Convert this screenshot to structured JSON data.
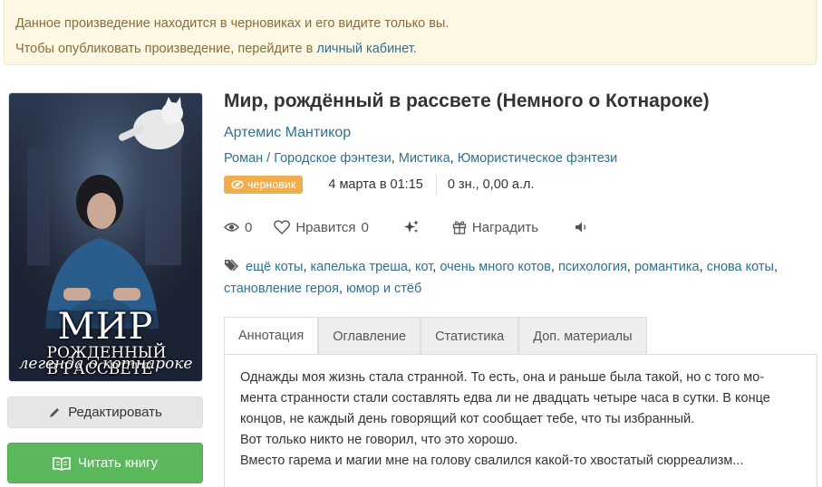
{
  "notice": {
    "line1": "Данное произведение находится в черновиках и его видите только вы.",
    "line2_prefix": "Чтобы опубликовать произведение, перейдите в ",
    "line2_link": "личный кабинет",
    "line2_suffix": "."
  },
  "cover": {
    "title_big": "МИР",
    "title_small_1": "РОЖДЕННЫЙ",
    "title_small_2": "В РАССВЕТЕ",
    "subtitle": "легенда о котнароке"
  },
  "buttons": {
    "edit": "Редактировать",
    "read": "Читать книгу"
  },
  "book": {
    "title": "Мир, рождённый в рассвете (Немного о Котнароке)",
    "author": "Артемис Мантикор",
    "genre_prefix": "Роман / ",
    "genres": [
      "Городское фэнтези",
      "Мистика",
      "Юмористическое фэнтези"
    ],
    "status_badge": "черновик",
    "date": "4 марта в 01:15",
    "size": "0 зн., 0,00 а.л."
  },
  "actions": {
    "views": "0",
    "likes_label": "Нравится",
    "likes_count": "0",
    "reward": "Наградить"
  },
  "tags": [
    "ещё коты",
    "капелька треша",
    "кот",
    "очень много котов",
    "психология",
    "романтика",
    "снова коты",
    "становление героя",
    "юмор и стёб"
  ],
  "tabs": [
    "Аннотация",
    "Оглавление",
    "Статистика",
    "Доп. материалы"
  ],
  "annotation": {
    "l1": "Однажды моя жизнь стала странной. То есть, она и раньше была такой, но с того мо-",
    "l2": "мента странности стали составлять едва ли не двадцать четыре часа в сутки. В конце",
    "l3": "концов, не каждый день говорящий кот сообщает тебе, что ты избранный.",
    "l4": "Вот только никто не говорил, что это хорошо.",
    "l5": "Вместо гарема и магии мне на голову свалился какой-то хвостатый сюрреализм..."
  },
  "colors": {
    "link": "#31708f",
    "notice_bg": "#fcf8e3",
    "notice_text": "#8a6d3b",
    "badge": "#f0ad4e",
    "read_button": "#5cb85c",
    "edit_button": "#e6e6e6"
  },
  "icons": [
    "eye-icon",
    "heart-icon",
    "sparkle-icon",
    "gift-icon",
    "speaker-icon",
    "tags-icon",
    "pencil-icon",
    "book-open-icon",
    "eye-slash-icon"
  ]
}
